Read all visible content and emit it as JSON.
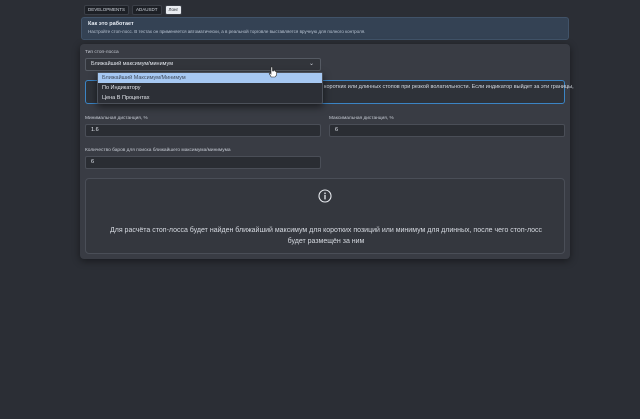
{
  "tabs": [
    {
      "label": "DEVELOPMENTS",
      "active": false
    },
    {
      "label": "ADAUSDT",
      "active": false
    },
    {
      "label": "Лонг",
      "active": true
    }
  ],
  "info": {
    "title": "Как это работает",
    "description": "Настройте стоп-лосс. В тестах он применяется автоматически, а в реальной торговле выставляется вручную для полного контроля."
  },
  "stop_loss": {
    "type_label": "Тип стоп-лосса",
    "selected": "Ближайший максимум/минимум",
    "options": [
      "Ближайший Максимум/Минимум",
      "По Индикатору",
      "Цена В Процентах"
    ],
    "highlighted_option": "Ближайший Максимум/Минимум"
  },
  "hint": {
    "text": "коротких или длинных стопов при резкой волатильности. Если индикатор выйдет за эти границы,"
  },
  "fields": {
    "min_distance": {
      "label": "Минимальная дистанция, %",
      "value": "1.6"
    },
    "max_distance": {
      "label": "Максимальная дистанция, %",
      "value": "6"
    },
    "bars_count": {
      "label": "Количество баров для поиска ближайшего максимума/минимума",
      "value": "6"
    }
  },
  "callout": {
    "icon": "info-icon",
    "text": "Для расчёта стоп-лосса будет найден ближайший максимум для коротких позиций или минимум для длинных, после чего стоп-лосс будет размещён за ним"
  },
  "colors": {
    "background": "#2b2e35",
    "panel": "#393c44",
    "accent": "#3b84c4",
    "selected_option": "#a6c8f2"
  }
}
